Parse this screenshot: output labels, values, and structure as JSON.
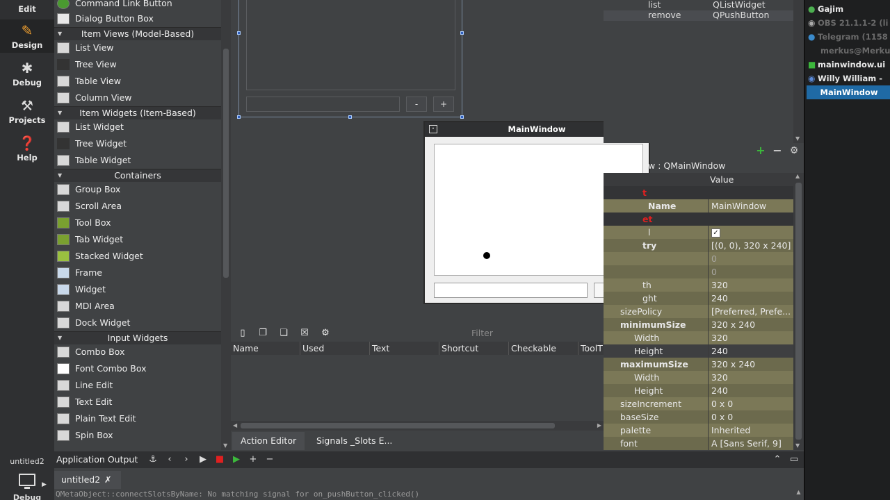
{
  "modebar": {
    "edit": "Edit",
    "design": "Design",
    "debug": "Debug",
    "projects": "Projects",
    "help": "Help",
    "kit_label": "untitled2",
    "kit_mode": "Debug"
  },
  "widgetbox": {
    "items_top": [
      "Command Link Button",
      "Dialog Button Box"
    ],
    "cat_item_views": "Item Views (Model-Based)",
    "item_views": [
      "List View",
      "Tree View",
      "Table View",
      "Column View"
    ],
    "cat_item_widgets": "Item Widgets (Item-Based)",
    "item_widgets": [
      "List Widget",
      "Tree Widget",
      "Table Widget"
    ],
    "cat_containers": "Containers",
    "containers": [
      "Group Box",
      "Scroll Area",
      "Tool Box",
      "Tab Widget",
      "Stacked Widget",
      "Frame",
      "Widget",
      "MDI Area",
      "Dock Widget"
    ],
    "cat_input": "Input Widgets",
    "inputs": [
      "Combo Box",
      "Font Combo Box",
      "Line Edit",
      "Text Edit",
      "Plain Text Edit",
      "Spin Box"
    ]
  },
  "form": {
    "minus": "-",
    "plus": "+"
  },
  "preview": {
    "title": "MainWindow",
    "minus": "-",
    "plus": "+"
  },
  "action_editor": {
    "filter_placeholder": "Filter",
    "columns": [
      "Name",
      "Used",
      "Text",
      "Shortcut",
      "Checkable",
      "ToolT"
    ],
    "tab_action_editor": "Action Editor",
    "tab_signals_slots": "Signals _Slots E..."
  },
  "object_inspector": {
    "rows": [
      {
        "object": "list",
        "class": "QListWidget"
      },
      {
        "object": "remove",
        "class": "QPushButton"
      }
    ]
  },
  "property_editor": {
    "class_label": "w : QMainWindow",
    "header_value": "Value",
    "rows": [
      {
        "key": "t",
        "value": ""
      },
      {
        "key": "Name",
        "value": "MainWindow"
      },
      {
        "key": "et",
        "value": ""
      },
      {
        "key": "l",
        "value": "✓"
      },
      {
        "key": "try",
        "value": "[(0, 0), 320 x 240]"
      },
      {
        "key": "",
        "value": "0"
      },
      {
        "key": "",
        "value": "0"
      },
      {
        "key": "th",
        "value": "320"
      },
      {
        "key": "ght",
        "value": "240"
      },
      {
        "key": "sizePolicy",
        "value": "[Preferred, Prefe..."
      },
      {
        "key": "minimumSize",
        "value": "320 x 240"
      },
      {
        "key": "Width",
        "value": "320"
      },
      {
        "key": "Height",
        "value": "240"
      },
      {
        "key": "maximumSize",
        "value": "320 x 240"
      },
      {
        "key": "Width",
        "value": "320"
      },
      {
        "key": "Height",
        "value": "240"
      },
      {
        "key": "sizeIncrement",
        "value": "0 x 0"
      },
      {
        "key": "baseSize",
        "value": "0 x 0"
      },
      {
        "key": "palette",
        "value": "Inherited"
      },
      {
        "key": "font",
        "value": "A  [Sans Serif, 9]"
      }
    ]
  },
  "output": {
    "title": "Application Output",
    "tab": "untitled2",
    "text": "QMetaObject::connectSlotsByName: No matching signal for on_pushButton_clicked()"
  },
  "taskbar": {
    "items": [
      "Gajim",
      "OBS 21.1.1-2 (li",
      "Telegram (1158",
      "merkus@Merkus",
      "mainwindow.ui",
      "Willy William -",
      "MainWindow"
    ]
  },
  "colors": {
    "accent": "#f0a030",
    "selection": "#1f6aa5",
    "property_row": "#7b7857",
    "section_text": "#e02020"
  }
}
